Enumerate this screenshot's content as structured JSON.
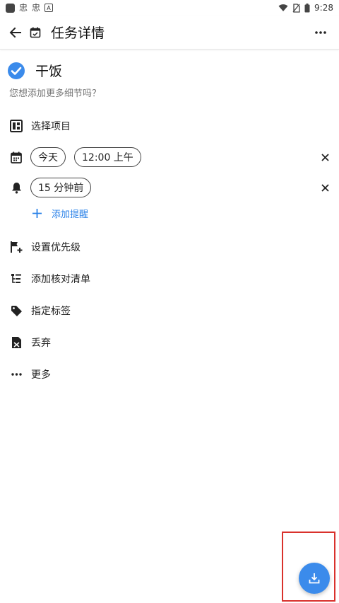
{
  "status_bar": {
    "time": "9:28",
    "notif_glyph": "忠"
  },
  "toolbar": {
    "title": "任务详情"
  },
  "task": {
    "title": "干饭",
    "hint": "您想添加更多细节吗？"
  },
  "rows": {
    "project": "选择项目",
    "date_chip": "今天",
    "time_chip": "12:00 上午",
    "reminder_chip": "15 分钟前",
    "add_reminder": "添加提醒",
    "priority": "设置优先级",
    "checklist": "添加核对清单",
    "tags": "指定标签",
    "discard": "丢弃",
    "more": "更多"
  },
  "colors": {
    "accent": "#3b8beb",
    "link": "#2b82e8",
    "highlight": "#d9312c"
  },
  "icons": [
    "back-arrow-icon",
    "calendar-check-icon",
    "more-horizontal-icon",
    "check-circle-icon",
    "project-board-icon",
    "calendar-icon",
    "bell-icon",
    "close-icon",
    "plus-icon",
    "flag-plus-icon",
    "checklist-icon",
    "tag-icon",
    "discard-icon",
    "download-icon"
  ]
}
